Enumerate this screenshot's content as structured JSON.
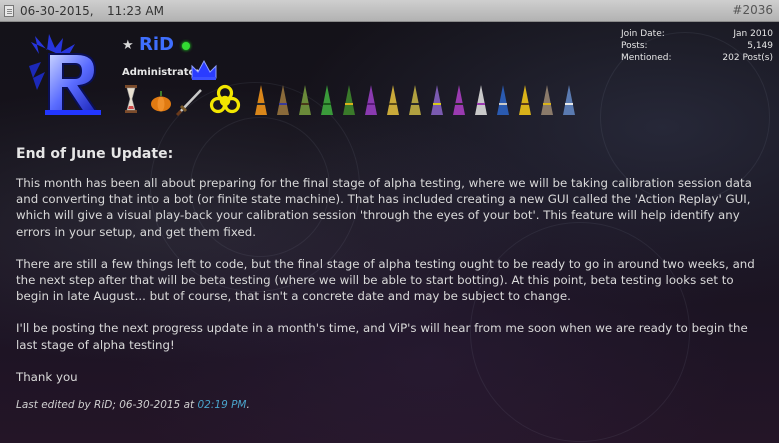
{
  "post_header": {
    "date": "06-30-2015,",
    "time": "11:23 AM",
    "post_number": "#2036",
    "icon": "post-icon"
  },
  "user": {
    "name": "RiD",
    "title": "Administrator",
    "rank_icon": "star-icon",
    "status_icon": "online-icon",
    "avatar_icon": "blue-r-avatar",
    "badge_icon": "crown-icon",
    "name_color": "#3f6fff",
    "awards": [
      "hourglass-icon",
      "pumpkin-icon",
      "sword-icon",
      "biohazard-icon",
      "party-hat-icon",
      "party-hat-icon",
      "party-hat-icon",
      "party-hat-icon",
      "party-hat-icon",
      "party-hat-icon",
      "party-hat-icon",
      "party-hat-icon",
      "party-hat-icon",
      "party-hat-icon",
      "party-hat-icon"
    ]
  },
  "stats": {
    "join_date_label": "Join Date:",
    "join_date_value": "Jan 2010",
    "posts_label": "Posts:",
    "posts_value": "5,149",
    "mentioned_label": "Mentioned:",
    "mentioned_value": "202 Post(s)"
  },
  "post": {
    "title": "End of June Update:",
    "paragraphs": [
      "This month has been all about preparing for the final stage of alpha testing, where we will be taking calibration session data and converting that into a bot (or finite state machine). That has included creating a new GUI called the 'Action Replay' GUI, which will give a visual play-back your calibration session 'through the eyes of your bot'. This feature will help identify any errors in your setup, and get them fixed.",
      "There are still a few things left to code, but the final stage of alpha testing ought to be ready to go in around two weeks, and the next step after that will be beta testing (where we will be able to start botting). At this point, beta testing looks set to begin in late August... but of course, that isn't a concrete date and may be subject to change.",
      "I'll be posting the next progress update in a month's time, and ViP's will hear from me soon when we are ready to begin the last stage of alpha testing!",
      "Thank you"
    ],
    "edit_prefix": "Last edited by RiD; 06-30-2015 at",
    "edit_time": "02:19 PM",
    "edit_suffix": "."
  }
}
